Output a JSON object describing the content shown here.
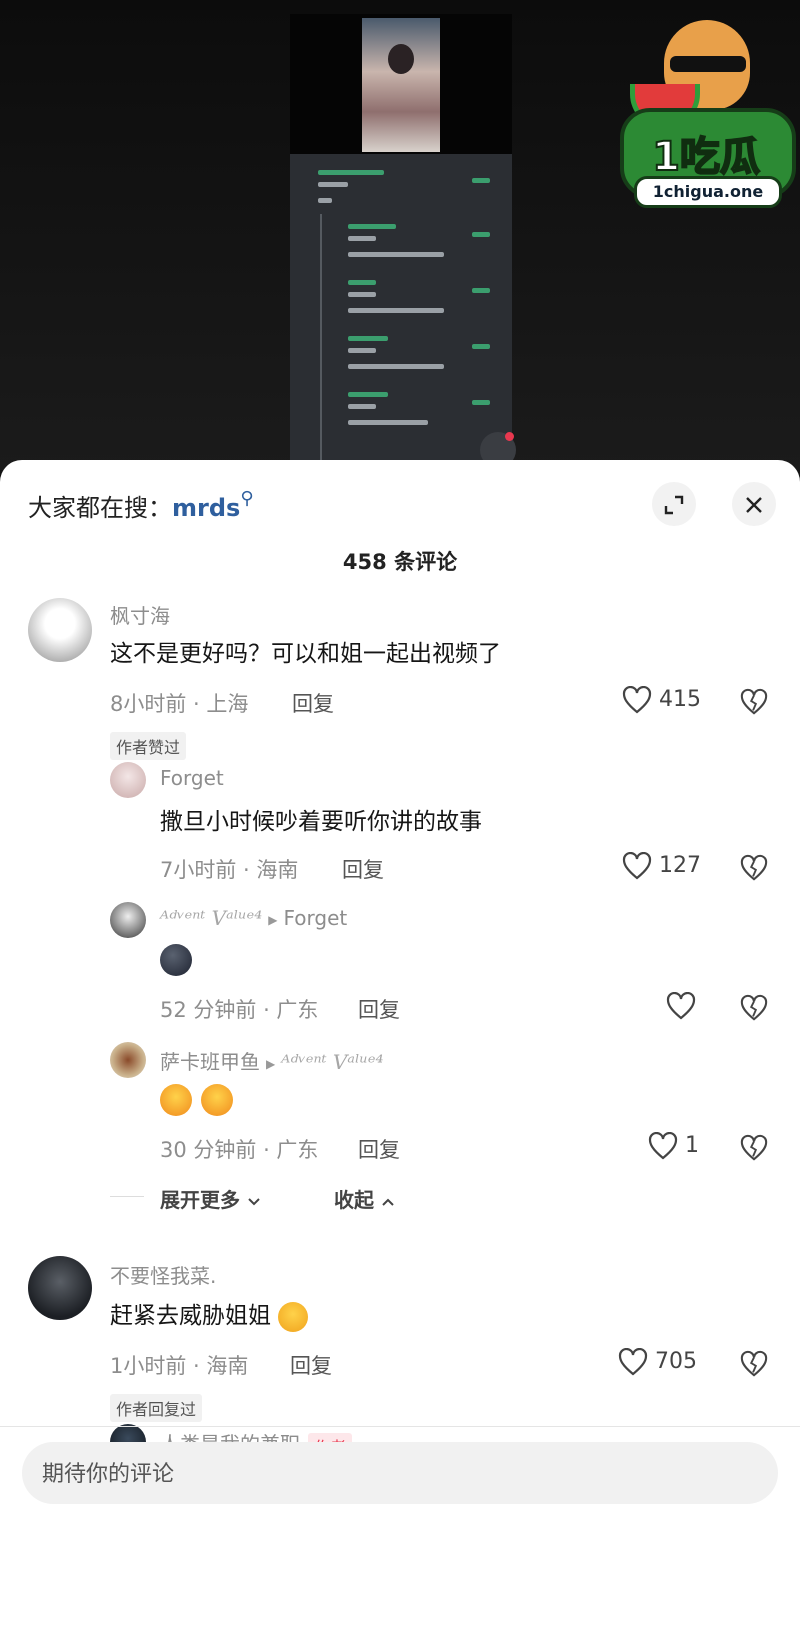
{
  "logo": {
    "brand": "1吃瓜",
    "url": "1chigua.one"
  },
  "sheet": {
    "search_prefix": "大家都在搜：",
    "search_term": "mrds",
    "comment_count": "458 条评论"
  },
  "comments": [
    {
      "user": "枫寸海",
      "text": "这不是更好吗？可以和姐一起出视频了",
      "time_location": "8小时前 · 上海",
      "reply_label": "回复",
      "likes": "415",
      "badge": "作者赞过",
      "replies": [
        {
          "user": "Forget",
          "text": "撒旦小时候吵着要听你讲的故事",
          "time_location": "7小时前 · 海南",
          "reply_label": "回复",
          "likes": "127"
        },
        {
          "user": "ᴬᵈᵛᵉⁿᵗ Vᵃˡᵘᵉ⁴",
          "reply_to": "Forget",
          "text": "",
          "time_location": "52 分钟前 · 广东",
          "reply_label": "回复",
          "likes": ""
        },
        {
          "user": "萨卡班甲鱼",
          "reply_to": "ᴬᵈᵛᵉⁿᵗ Vᵃˡᵘᵉ⁴",
          "text": "",
          "time_location": "30 分钟前 · 广东",
          "reply_label": "回复",
          "likes": "1"
        }
      ],
      "expand_more": "展开更多",
      "collapse": "收起"
    },
    {
      "user": "不要怪我菜.",
      "text": "赶紧去威胁姐姐",
      "time_location": "1小时前 · 海南",
      "reply_label": "回复",
      "likes": "705",
      "badge": "作者回复过",
      "replies": [
        {
          "user": "人类是我的兼职",
          "author_tag": "作者"
        }
      ]
    }
  ],
  "input": {
    "placeholder": "期待你的评论"
  },
  "icons": [
    "search-icon",
    "expand-icon",
    "close-icon",
    "heart-icon",
    "broken-heart-icon",
    "chevron-down-icon",
    "chevron-up-icon",
    "triangle-right-icon"
  ],
  "colors": {
    "accent_blue": "#2f5f9e",
    "author_red": "#e8384f",
    "sheet_bg": "#ffffff"
  }
}
